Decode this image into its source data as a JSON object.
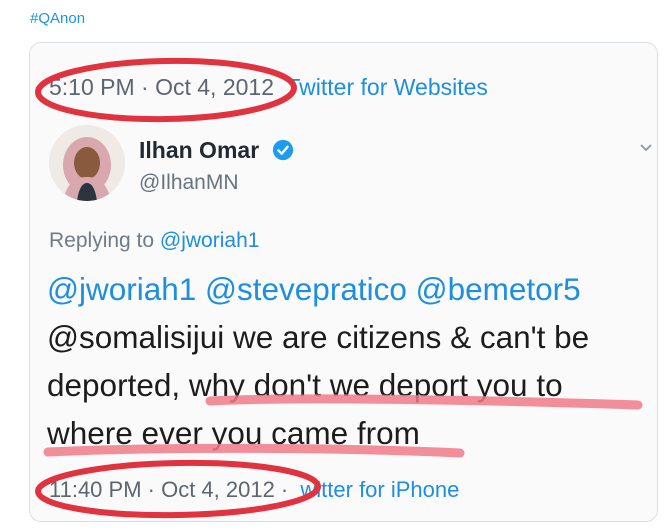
{
  "hashtag": "#QAnon",
  "tweet": {
    "timestamp_top": "5:10 PM · Oct 4, 2012",
    "source_top": "Twitter for Websites",
    "author_name": "Ilhan Omar",
    "author_handle": "@IlhanMN",
    "replying_prefix": "Replying to",
    "replying_to": "@jworiah1",
    "mentions_line": "@jworiah1 @stevepratico @bemetor5",
    "line2": "@somalisijui we are citizens & can't be",
    "line3": "deported, why don't we deport you to",
    "line4": "where ever you came from",
    "timestamp_bottom": "11:40 PM · Oct 4, 2012 ·",
    "source_bottom": "witter for iPhone"
  },
  "icons": {
    "verified": "verified-badge-icon",
    "chevron": "chevron-down-icon",
    "avatar": "avatar"
  },
  "colors": {
    "link": "#1b95e0",
    "annotation_red": "#e0323f"
  }
}
